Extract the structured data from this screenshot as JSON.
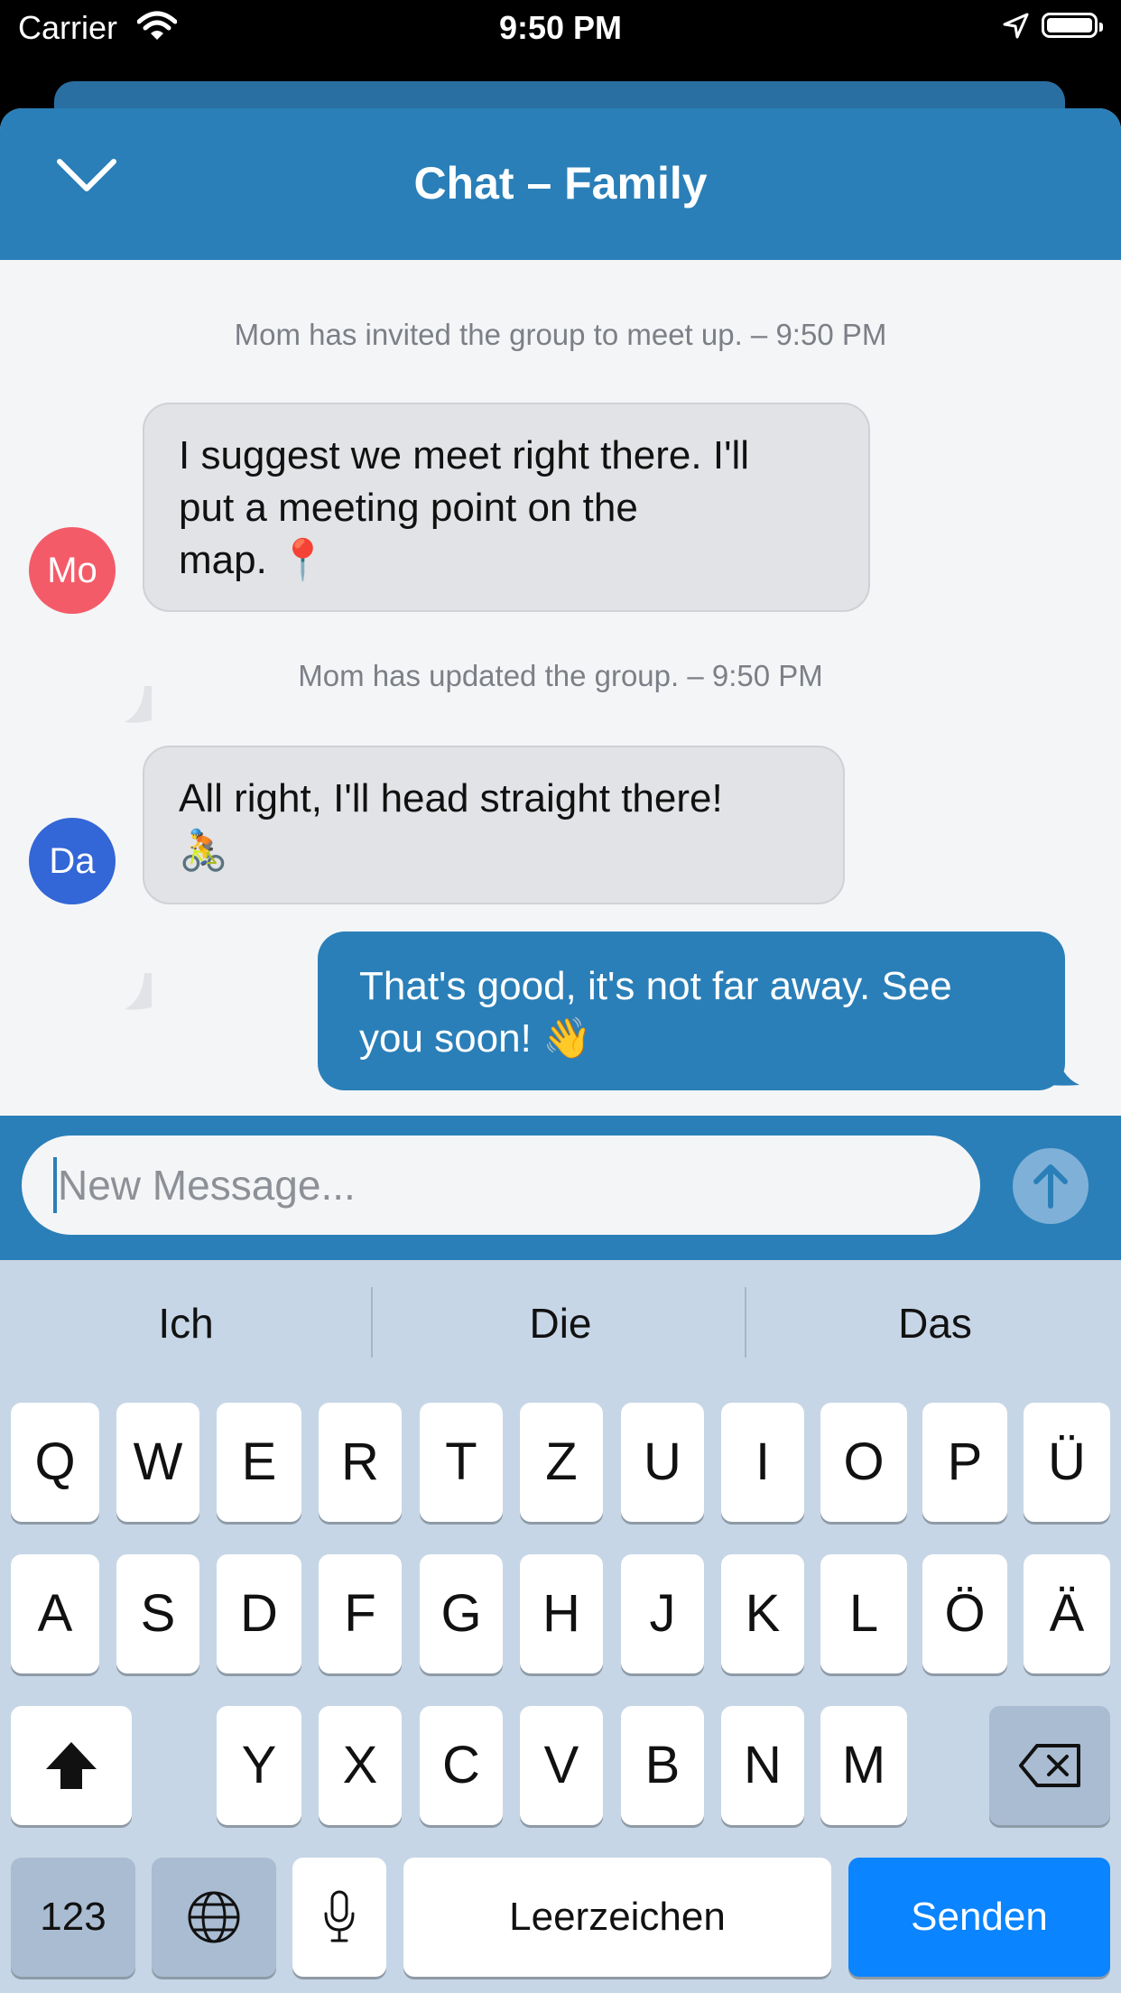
{
  "status_bar": {
    "carrier": "Carrier",
    "time": "9:50 PM"
  },
  "header": {
    "title": "Chat – Family"
  },
  "messages": [
    {
      "kind": "system",
      "text": "Mom has invited the group to meet up. – 9:50 PM"
    },
    {
      "kind": "incoming",
      "avatar": "Mo",
      "avatar_color": "#f45b69",
      "lines": [
        "I suggest we meet right there. I'll",
        "put a meeting point on the",
        "map. 📍"
      ]
    },
    {
      "kind": "system",
      "text": "Mom has updated the group. – 9:50 PM"
    },
    {
      "kind": "incoming",
      "avatar": "Da",
      "avatar_color": "#3366d6",
      "lines": [
        "All right, I'll head straight there!",
        "🚴"
      ]
    },
    {
      "kind": "outgoing",
      "lines": [
        "That's good, it's not far away. See",
        "you soon! 👋"
      ]
    }
  ],
  "composer": {
    "placeholder": "New Message...",
    "send_icon": "arrow-up-icon"
  },
  "keyboard": {
    "suggestions": [
      "Ich",
      "Die",
      "Das"
    ],
    "row1": [
      "Q",
      "W",
      "E",
      "R",
      "T",
      "Z",
      "U",
      "I",
      "O",
      "P",
      "Ü"
    ],
    "row2": [
      "A",
      "S",
      "D",
      "F",
      "G",
      "H",
      "J",
      "K",
      "L",
      "Ö",
      "Ä"
    ],
    "row3": [
      "Y",
      "X",
      "C",
      "V",
      "B",
      "N",
      "M"
    ],
    "numbers_label": "123",
    "space_label": "Leerzeichen",
    "return_label": "Senden"
  },
  "colors": {
    "accent": "#2a7fb8",
    "keyboard_bg": "#c6d6e6",
    "return_key": "#0a84ff"
  }
}
